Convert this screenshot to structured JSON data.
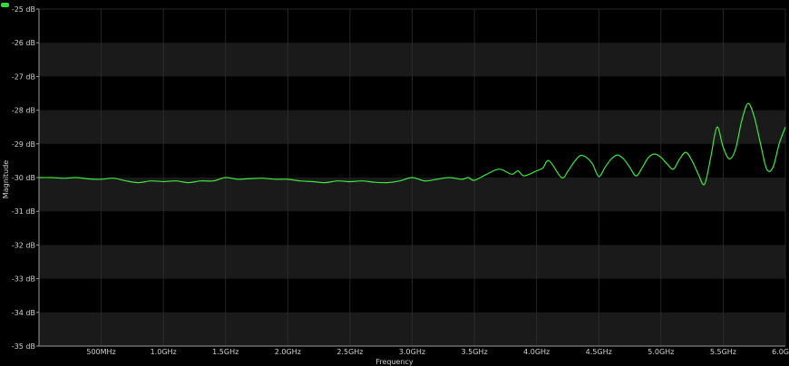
{
  "chart_data": {
    "type": "line",
    "xlabel": "Frequency",
    "ylabel": "Magnitude",
    "xlim_hz": [
      0,
      6000000000
    ],
    "ylim": [
      -35,
      -25
    ],
    "x_ticks": [
      {
        "value": 500000000,
        "label": "500MHz"
      },
      {
        "value": 1000000000,
        "label": "1.0GHz"
      },
      {
        "value": 1500000000,
        "label": "1.5GHz"
      },
      {
        "value": 2000000000,
        "label": "2.0GHz"
      },
      {
        "value": 2500000000,
        "label": "2.5GHz"
      },
      {
        "value": 3000000000,
        "label": "3.0GHz"
      },
      {
        "value": 3500000000,
        "label": "3.5GHz"
      },
      {
        "value": 4000000000,
        "label": "4.0GHz"
      },
      {
        "value": 4500000000,
        "label": "4.5GHz"
      },
      {
        "value": 5000000000,
        "label": "5.0GHz"
      },
      {
        "value": 5500000000,
        "label": "5.5GHz"
      },
      {
        "value": 6000000000,
        "label": "6.0G"
      }
    ],
    "y_ticks": [
      {
        "value": -25,
        "label": "-25 dB"
      },
      {
        "value": -26,
        "label": "-26 dB"
      },
      {
        "value": -27,
        "label": "-27 dB"
      },
      {
        "value": -28,
        "label": "-28 dB"
      },
      {
        "value": -29,
        "label": "-29 dB"
      },
      {
        "value": -30,
        "label": "-30 dB"
      },
      {
        "value": -31,
        "label": "-31 dB"
      },
      {
        "value": -32,
        "label": "-32 dB"
      },
      {
        "value": -33,
        "label": "-33 dB"
      },
      {
        "value": -34,
        "label": "-34 dB"
      },
      {
        "value": -35,
        "label": "-35 dB"
      }
    ],
    "grid": true,
    "colors": {
      "trace": "#3ee63e",
      "band": "#1a1a1a",
      "grid": "#2e2e2e",
      "axis": "#9a9a9a",
      "marker": "#2fdc3a"
    },
    "series": [
      {
        "x": [
          0,
          100000000,
          200000000,
          300000000,
          400000000,
          500000000,
          600000000,
          700000000,
          800000000,
          900000000,
          1000000000,
          1100000000,
          1200000000,
          1300000000,
          1400000000,
          1500000000,
          1600000000,
          1700000000,
          1800000000,
          1900000000,
          2000000000,
          2100000000,
          2200000000,
          2300000000,
          2400000000,
          2500000000,
          2600000000,
          2700000000,
          2800000000,
          2900000000,
          3000000000,
          3100000000,
          3200000000,
          3300000000,
          3400000000,
          3450000000,
          3500000000,
          3600000000,
          3700000000,
          3800000000,
          3850000000,
          3900000000,
          4000000000,
          4050000000,
          4100000000,
          4200000000,
          4250000000,
          4300000000,
          4350000000,
          4400000000,
          4450000000,
          4500000000,
          4550000000,
          4600000000,
          4650000000,
          4700000000,
          4750000000,
          4800000000,
          4850000000,
          4900000000,
          4950000000,
          5000000000,
          5050000000,
          5100000000,
          5150000000,
          5200000000,
          5250000000,
          5300000000,
          5350000000,
          5400000000,
          5450000000,
          5500000000,
          5550000000,
          5600000000,
          5650000000,
          5700000000,
          5750000000,
          5800000000,
          5850000000,
          5900000000,
          5950000000,
          6000000000
        ],
        "values": [
          -30.0,
          -30.0,
          -30.02,
          -30.0,
          -30.04,
          -30.05,
          -30.02,
          -30.1,
          -30.15,
          -30.1,
          -30.12,
          -30.1,
          -30.15,
          -30.1,
          -30.1,
          -30.0,
          -30.05,
          -30.03,
          -30.02,
          -30.05,
          -30.05,
          -30.1,
          -30.12,
          -30.15,
          -30.1,
          -30.12,
          -30.1,
          -30.14,
          -30.15,
          -30.1,
          -30.0,
          -30.1,
          -30.05,
          -30.0,
          -30.05,
          -30.0,
          -30.08,
          -29.9,
          -29.75,
          -29.9,
          -29.8,
          -29.95,
          -29.8,
          -29.72,
          -29.5,
          -30.0,
          -29.82,
          -29.55,
          -29.35,
          -29.4,
          -29.6,
          -29.97,
          -29.7,
          -29.45,
          -29.33,
          -29.45,
          -29.7,
          -29.95,
          -29.7,
          -29.4,
          -29.3,
          -29.4,
          -29.6,
          -29.75,
          -29.45,
          -29.25,
          -29.5,
          -29.9,
          -30.2,
          -29.4,
          -28.5,
          -29.1,
          -29.45,
          -29.15,
          -28.3,
          -27.8,
          -28.2,
          -29.0,
          -29.75,
          -29.7,
          -29.0,
          -28.5
        ]
      }
    ]
  }
}
